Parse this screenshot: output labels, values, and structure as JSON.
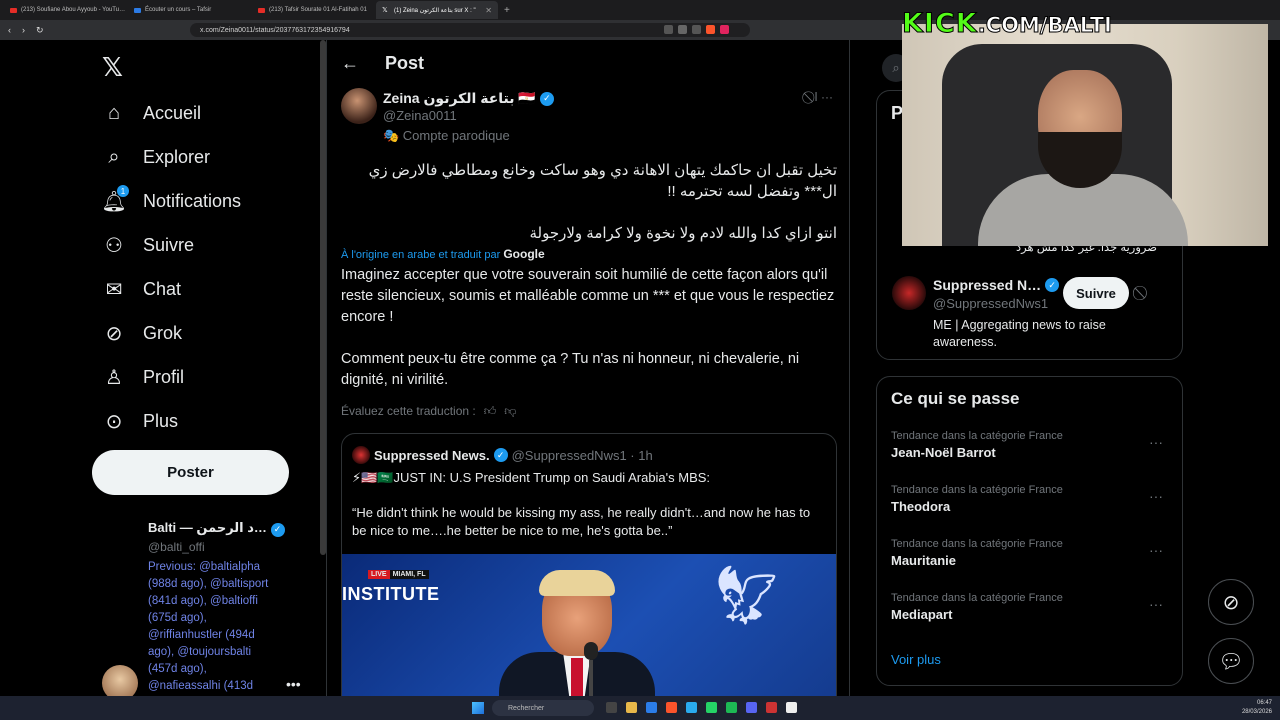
{
  "browser": {
    "tabs": [
      {
        "label": "(213) Soufiane Abou Ayyoub - YouTu…"
      },
      {
        "label": "Écouter un cours – Tafsir"
      },
      {
        "label": "(213) Tafsir Sourate 01 Al-Fatihah 01"
      },
      {
        "label": "(1) Zeina بتاعة الكرتون sur X : \""
      }
    ],
    "url": "x.com/Zeina0011/status/2037763172354916794"
  },
  "nav": {
    "items": [
      {
        "label": "Accueil",
        "icon": "home-icon"
      },
      {
        "label": "Explorer",
        "icon": "search-icon"
      },
      {
        "label": "Notifications",
        "icon": "bell-icon",
        "badge": "1"
      },
      {
        "label": "Suivre",
        "icon": "add-person-icon"
      },
      {
        "label": "Chat",
        "icon": "mail-icon"
      },
      {
        "label": "Grok",
        "icon": "grok-icon"
      },
      {
        "label": "Profil",
        "icon": "person-icon"
      },
      {
        "label": "Plus",
        "icon": "more-circle-icon"
      }
    ],
    "post_button": "Poster",
    "account": {
      "name": "Balti — د الرحمن…",
      "handle": "@balti_offi",
      "bio": "Previous: @baltialpha (988d ago), @baltisport (841d ago), @baltioffi (675d ago), @riffianhustler (494d ago), @toujoursbalti (457d ago), @nafieassalhi (413d"
    }
  },
  "post": {
    "header_title": "Post",
    "author_name": "Zeina بتاعة الكرتون 🇪🇬",
    "author_handle": "@Zeina0011",
    "parody_label": "🎭 Compte parodique",
    "top_actions": "⃠ ا  ···",
    "arabic_line1": "تخيل تقبل ان حاكمك يتهان الاهانة دي وهو ساكت وخانع ومطاطي فالارض زي ال*** وتفضل لسه تحترمه !!",
    "arabic_line2": "انتو ازاي كدا والله لادم ولا نخوة ولا كرامة ولارجولة",
    "translated_prefix": "À l'origine en arabe et traduit par",
    "translated_provider": "Google",
    "translation_p1": "Imaginez accepter que votre souverain soit humilié de cette façon alors qu'il reste silencieux, soumis et malléable comme un *** et que vous le respectiez encore !",
    "translation_p2": "Comment peux-tu être comme ça ? Tu n'as ni honneur, ni chevalerie, ni dignité, ni virilité.",
    "rate_label": "Évaluez cette traduction :",
    "quote": {
      "name": "Suppressed News.",
      "handle": "@SuppressedNws1 · 1h",
      "line1": "⚡🇺🇸🇸🇦JUST IN: U.S President Trump on Saudi Arabia's MBS:",
      "line2": "“He didn't think he would be kissing my ass, he really didn't…and now he has to be nice to me….he better be nice to me, he's gotta be..”",
      "media_live": "LIVE",
      "media_location": "MIAMI, FL",
      "media_banner": "INSTITUTE"
    }
  },
  "right": {
    "who_title": "P",
    "arabic_snippet": "ضرورية جدا. غير كدا مش هرد",
    "suggestion": {
      "name": "Suppressed N…",
      "handle": "@SuppressedNws1",
      "bio": "ME | Aggregating news to raise awareness.",
      "follow": "Suivre"
    },
    "trends_title": "Ce qui se passe",
    "trends": [
      {
        "category": "Tendance dans la catégorie France",
        "name": "Jean-Noël Barrot"
      },
      {
        "category": "Tendance dans la catégorie France",
        "name": "Theodora"
      },
      {
        "category": "Tendance dans la catégorie France",
        "name": "Mauritanie"
      },
      {
        "category": "Tendance dans la catégorie France",
        "name": "Mediapart"
      }
    ],
    "see_more": "Voir plus"
  },
  "overlay": {
    "kick": "KICK",
    "rest": ".COM/BALTI"
  },
  "taskbar": {
    "search_placeholder": "Rechercher",
    "time": "06:47",
    "date": "28/03/2026"
  },
  "colors": {
    "accent": "#1d9bf0",
    "background": "#000000",
    "kick_green": "#53fc18"
  }
}
